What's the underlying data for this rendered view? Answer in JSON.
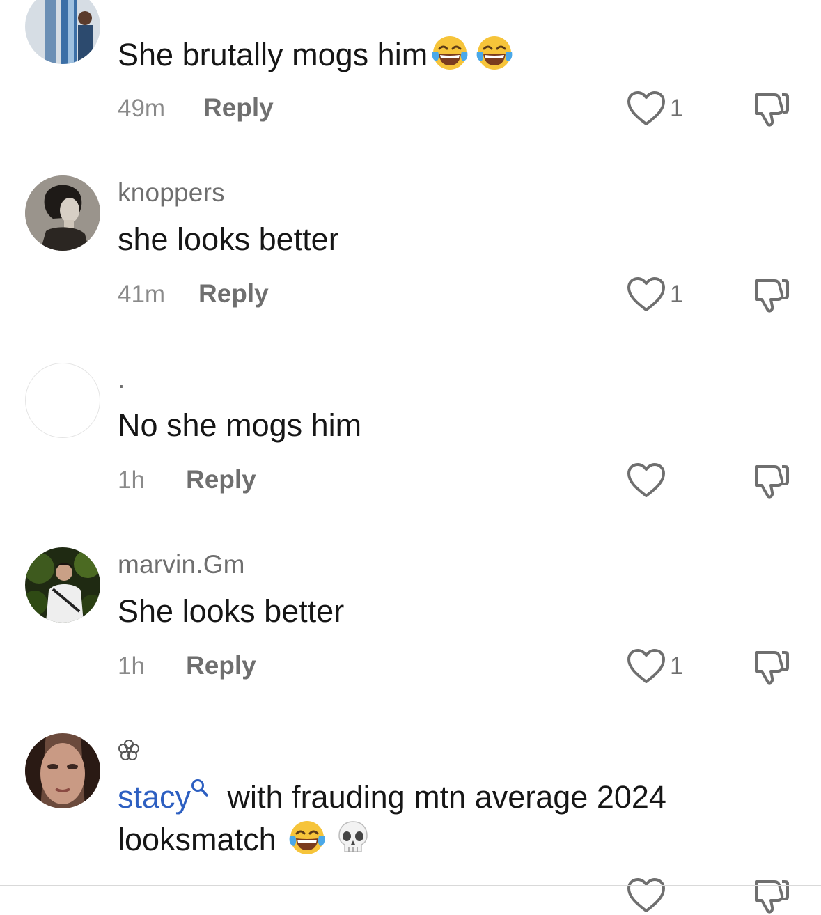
{
  "comments": [
    {
      "username": "",
      "text": "She brutally mogs him",
      "time": "49m",
      "reply_label": "Reply",
      "likes": "1"
    },
    {
      "username": "knoppers",
      "text": "she looks better",
      "time": "41m",
      "reply_label": "Reply",
      "likes": "1"
    },
    {
      "username": ".",
      "text": "No she mogs him",
      "time": "1h",
      "reply_label": "Reply",
      "likes": ""
    },
    {
      "username": "marvin.Gm",
      "text": "She looks better",
      "time": "1h",
      "reply_label": "Reply",
      "likes": "1"
    },
    {
      "username": "❀",
      "mention": "stacy",
      "text_line1": " with frauding mtn average 2024",
      "text_line2": "looksmatch ",
      "time": "",
      "reply_label": "",
      "likes": ""
    }
  ],
  "icons": {
    "like": "heart-outline-icon",
    "dislike": "thumbs-down-icon",
    "emoji_laugh": "face-with-tears-of-joy-emoji",
    "emoji_skull": "skull-emoji",
    "mention_search": "search-magnifier-icon"
  },
  "colors": {
    "text": "#161616",
    "secondary": "#6f6f6f",
    "mention": "#2d5fc1"
  }
}
